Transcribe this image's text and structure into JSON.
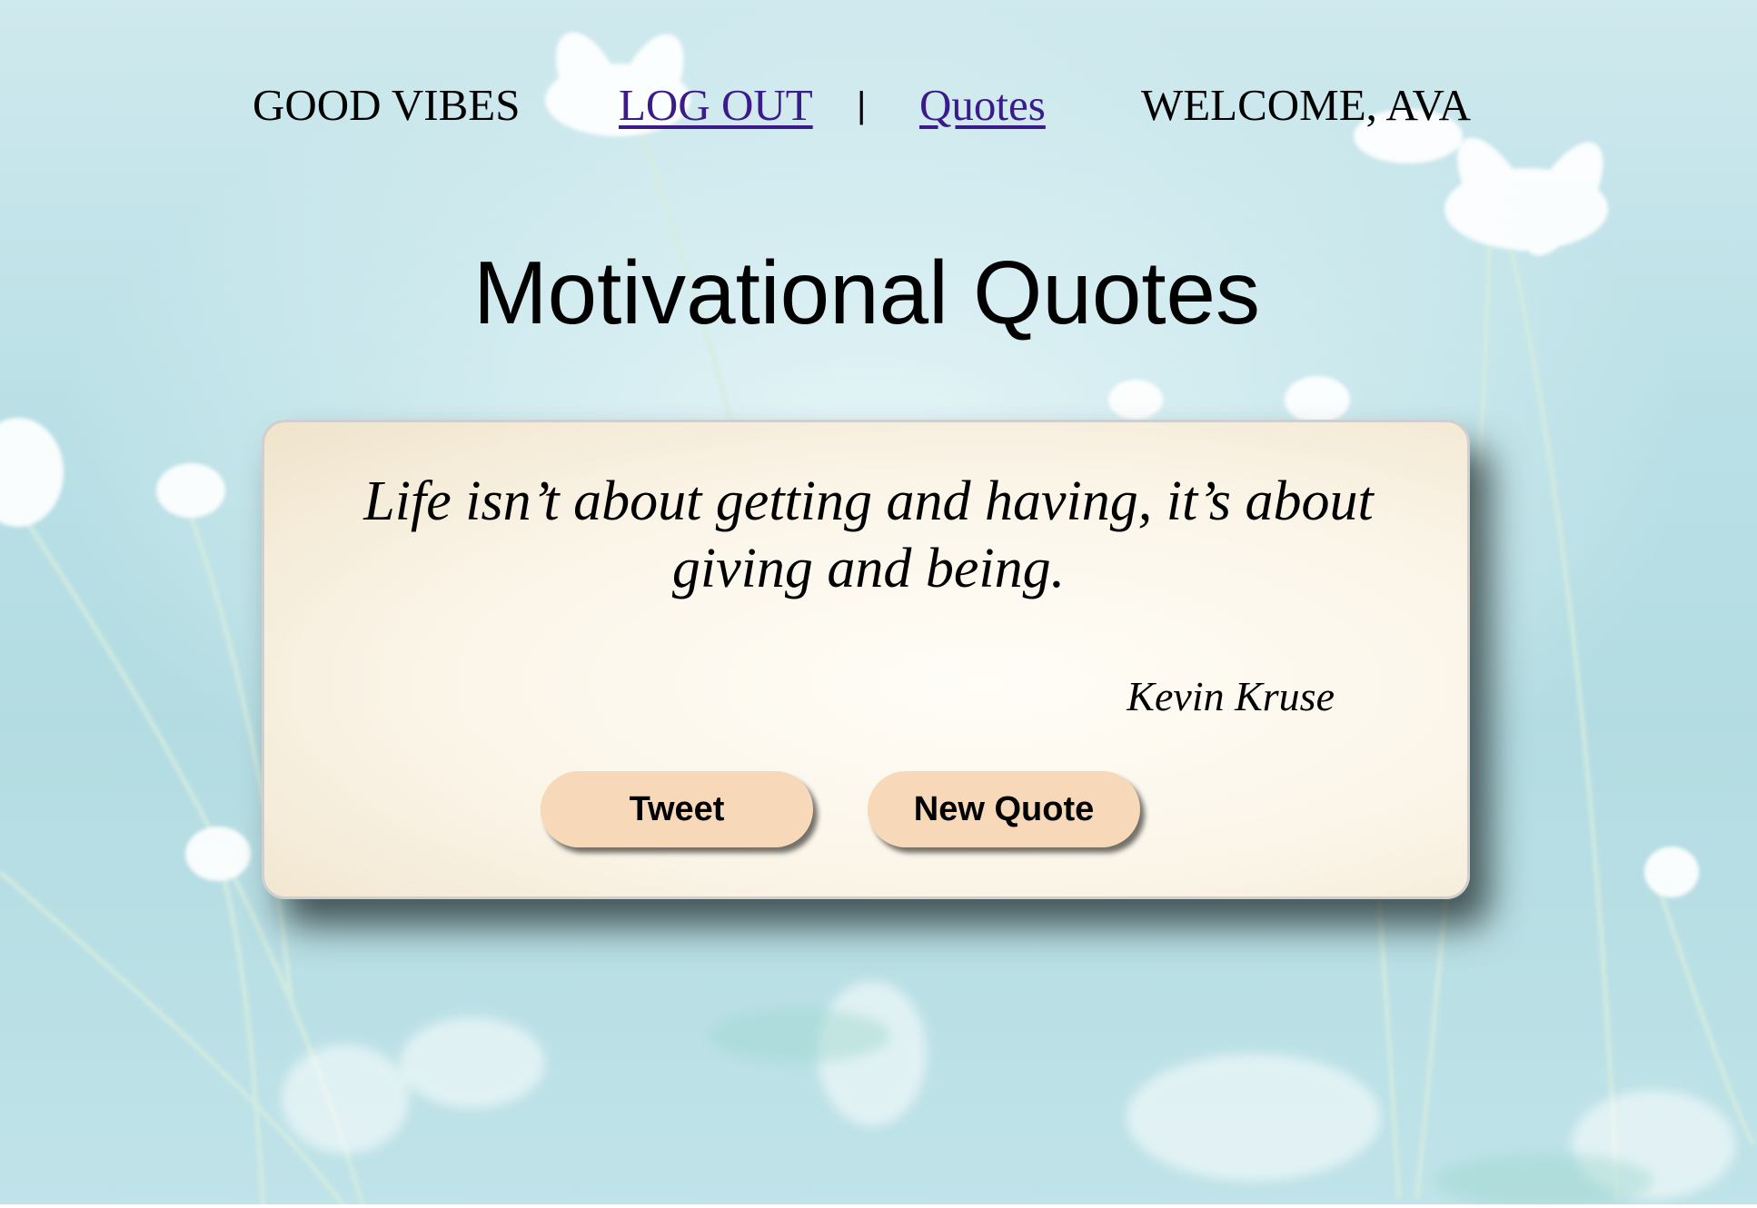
{
  "nav": {
    "brand": "GOOD VIBES",
    "logout_label": "LOG OUT",
    "separator": "|",
    "quotes_label": "Quotes",
    "welcome_text": "WELCOME, AVA",
    "link_color": "#3b1a8a"
  },
  "main": {
    "title": "Motivational Quotes"
  },
  "quote_card": {
    "text": "Life isn’t about getting and having, it’s about giving and being.",
    "author": "Kevin Kruse",
    "tweet_label": "Tweet",
    "new_quote_label": "New Quote",
    "button_color": "#f7d9b9"
  },
  "background": {
    "description_icon": "white-daisies-background"
  }
}
